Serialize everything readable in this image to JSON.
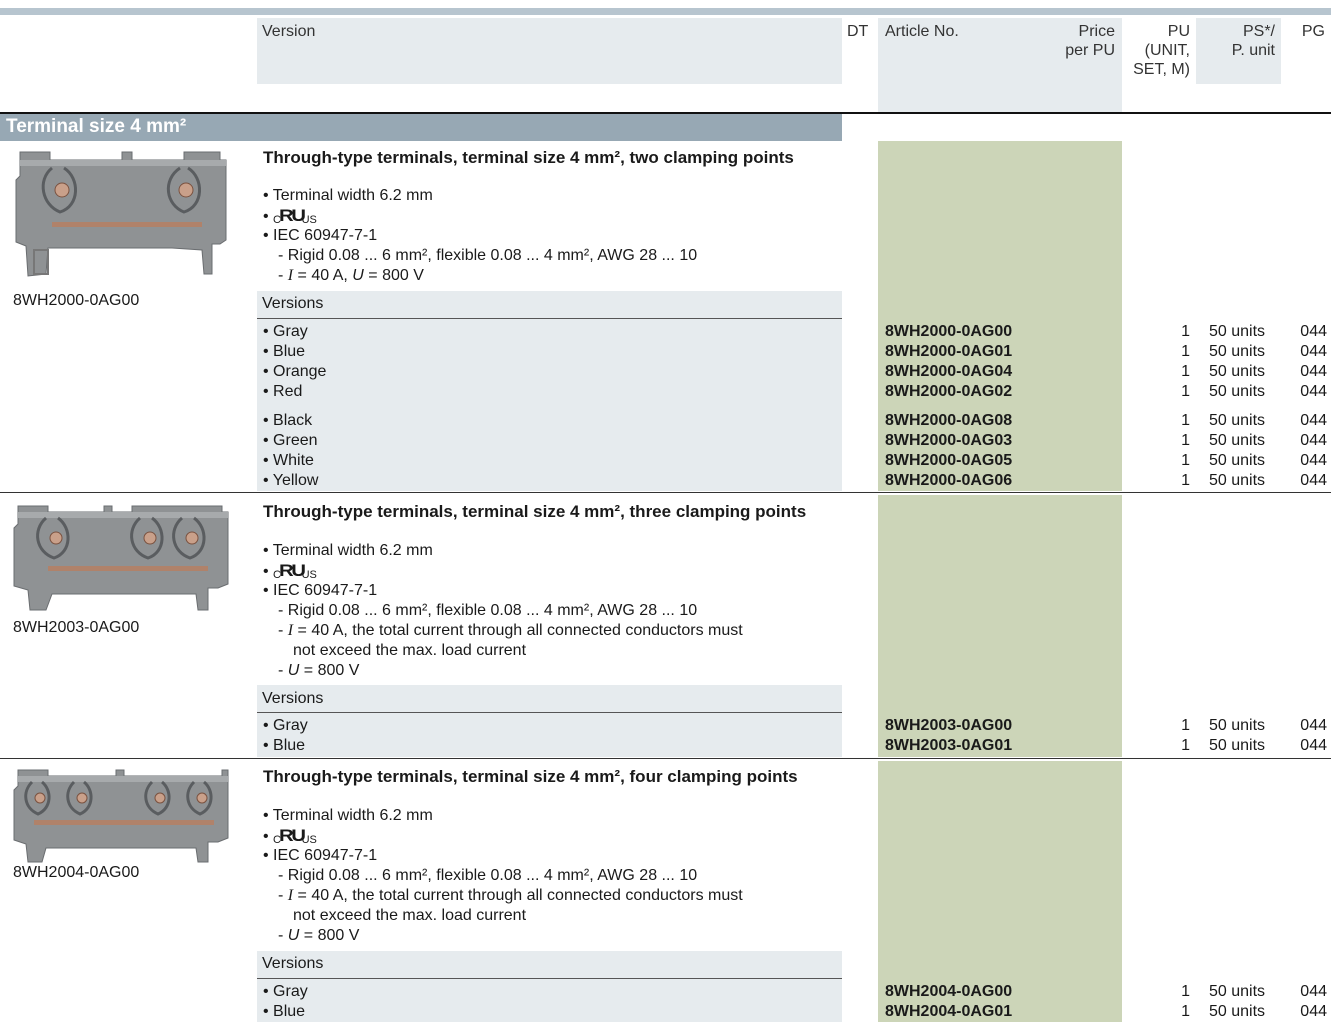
{
  "header": {
    "version": "Version",
    "dt": "DT",
    "article": "Article No.",
    "price": [
      "Price",
      "per PU"
    ],
    "pu": [
      "PU",
      "(UNIT,",
      "SET, M)"
    ],
    "ps": [
      "PS*/",
      "P. unit"
    ],
    "pg": "PG"
  },
  "section_title": "Terminal size 4 mm²",
  "versions_label": "Versions",
  "ul_mark": {
    "c": "C",
    "mark": "RU",
    "us": "US"
  },
  "products": [
    {
      "caption": "8WH2000-0AG00",
      "title": "Through-type terminals, terminal size 4 mm², two clamping points",
      "width": "• Terminal width 6.2 mm",
      "iec": "• IEC 60947-7-1",
      "specs": [
        "- Rigid 0.08 ... 6 mm², flexible 0.08 ... 4 mm², AWG 28 ... 10",
        "- I = 40 A, U = 800 V"
      ],
      "versions": [
        {
          "color": "• Gray",
          "article": "8WH2000-0AG00",
          "pu": "1",
          "ps": "50 units",
          "pg": "044"
        },
        {
          "color": "• Blue",
          "article": "8WH2000-0AG01",
          "pu": "1",
          "ps": "50 units",
          "pg": "044"
        },
        {
          "color": "• Orange",
          "article": "8WH2000-0AG04",
          "pu": "1",
          "ps": "50 units",
          "pg": "044"
        },
        {
          "color": "• Red",
          "article": "8WH2000-0AG02",
          "pu": "1",
          "ps": "50 units",
          "pg": "044"
        },
        {
          "color": "• Black",
          "article": "8WH2000-0AG08",
          "pu": "1",
          "ps": "50 units",
          "pg": "044"
        },
        {
          "color": "• Green",
          "article": "8WH2000-0AG03",
          "pu": "1",
          "ps": "50 units",
          "pg": "044"
        },
        {
          "color": "• White",
          "article": "8WH2000-0AG05",
          "pu": "1",
          "ps": "50 units",
          "pg": "044"
        },
        {
          "color": "• Yellow",
          "article": "8WH2000-0AG06",
          "pu": "1",
          "ps": "50 units",
          "pg": "044"
        }
      ]
    },
    {
      "caption": "8WH2003-0AG00",
      "title": "Through-type terminals, terminal size 4 mm², three clamping points",
      "width": "• Terminal width 6.2 mm",
      "iec": "• IEC 60947-7-1",
      "specs": [
        "- Rigid 0.08 ... 6 mm², flexible 0.08 ... 4 mm², AWG 28 ... 10",
        "- I = 40 A, the total current through all connected conductors must",
        "not exceed the max. load current",
        "- U = 800 V"
      ],
      "versions": [
        {
          "color": "• Gray",
          "article": "8WH2003-0AG00",
          "pu": "1",
          "ps": "50 units",
          "pg": "044"
        },
        {
          "color": "• Blue",
          "article": "8WH2003-0AG01",
          "pu": "1",
          "ps": "50 units",
          "pg": "044"
        }
      ]
    },
    {
      "caption": "8WH2004-0AG00",
      "title": "Through-type terminals, terminal size 4 mm², four clamping points",
      "width": "• Terminal width 6.2 mm",
      "iec": "• IEC 60947-7-1",
      "specs": [
        "- Rigid 0.08 ... 6 mm², flexible 0.08 ... 4 mm², AWG 28 ... 10",
        "- I = 40 A, the total current through all connected conductors must",
        "not exceed the max. load current",
        "- U = 800 V"
      ],
      "versions": [
        {
          "color": "• Gray",
          "article": "8WH2004-0AG00",
          "pu": "1",
          "ps": "50 units",
          "pg": "044"
        },
        {
          "color": "• Blue",
          "article": "8WH2004-0AG01",
          "pu": "1",
          "ps": "50 units",
          "pg": "044"
        }
      ]
    }
  ]
}
